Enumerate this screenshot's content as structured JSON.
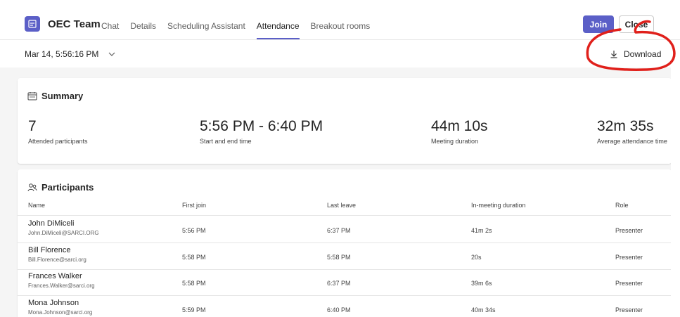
{
  "header": {
    "team_name": "OEC Team",
    "tabs": [
      {
        "label": "Chat"
      },
      {
        "label": "Details"
      },
      {
        "label": "Scheduling Assistant"
      },
      {
        "label": "Attendance",
        "active": true
      },
      {
        "label": "Breakout rooms"
      }
    ],
    "join_label": "Join",
    "close_label": "Close"
  },
  "toolbar": {
    "date_value": "Mar 14, 5:56:16 PM",
    "download_label": "Download"
  },
  "summary": {
    "title": "Summary",
    "stats": [
      {
        "value": "7",
        "label": "Attended participants"
      },
      {
        "value": "5:56 PM - 6:40 PM",
        "label": "Start and end time"
      },
      {
        "value": "44m 10s",
        "label": "Meeting duration"
      },
      {
        "value": "32m 35s",
        "label": "Average attendance time"
      }
    ]
  },
  "participants": {
    "title": "Participants",
    "columns": [
      "Name",
      "First join",
      "Last leave",
      "In-meeting duration",
      "Role"
    ],
    "rows": [
      {
        "name": "John DiMiceli",
        "email": "John.DiMiceli@SARCI.ORG",
        "first_join": "5:56 PM",
        "last_leave": "6:37 PM",
        "duration": "41m 2s",
        "role": "Presenter"
      },
      {
        "name": "Bill Florence",
        "email": "Bill.Florence@sarci.org",
        "first_join": "5:58 PM",
        "last_leave": "5:58 PM",
        "duration": "20s",
        "role": "Presenter"
      },
      {
        "name": "Frances Walker",
        "email": "Frances.Walker@sarci.org",
        "first_join": "5:58 PM",
        "last_leave": "6:37 PM",
        "duration": "39m 6s",
        "role": "Presenter"
      },
      {
        "name": "Mona Johnson",
        "email": "Mona.Johnson@sarci.org",
        "first_join": "5:59 PM",
        "last_leave": "6:40 PM",
        "duration": "40m 34s",
        "role": "Presenter"
      }
    ]
  },
  "colors": {
    "accent": "#5b5fc7",
    "annotation": "#e0201b"
  }
}
